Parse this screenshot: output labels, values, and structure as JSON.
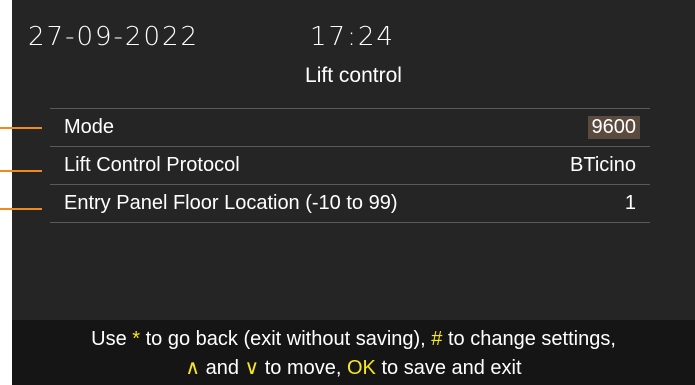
{
  "status": {
    "date": "27-09-2022",
    "time": "17:24"
  },
  "title": "Lift control",
  "rows": [
    {
      "label": "Mode",
      "value": "9600",
      "selected": true
    },
    {
      "label": "Lift Control Protocol",
      "value": "BTicino",
      "selected": false
    },
    {
      "label": "Entry Panel Floor Location (-10 to 99)",
      "value": "1",
      "selected": false
    }
  ],
  "footer": {
    "p1": "Use ",
    "k1": "*",
    "p2": " to go back (exit without saving), ",
    "k2": "#",
    "p3": " to change settings,",
    "k3": "∧",
    "p4": " and ",
    "k4": "∨",
    "p5": " to move, ",
    "k5": "OK",
    "p6": " to save and exit"
  },
  "colors": {
    "callout": "#f08a1c",
    "highlight": "#f6e71f",
    "selected_bg": "#5b4a3e"
  }
}
